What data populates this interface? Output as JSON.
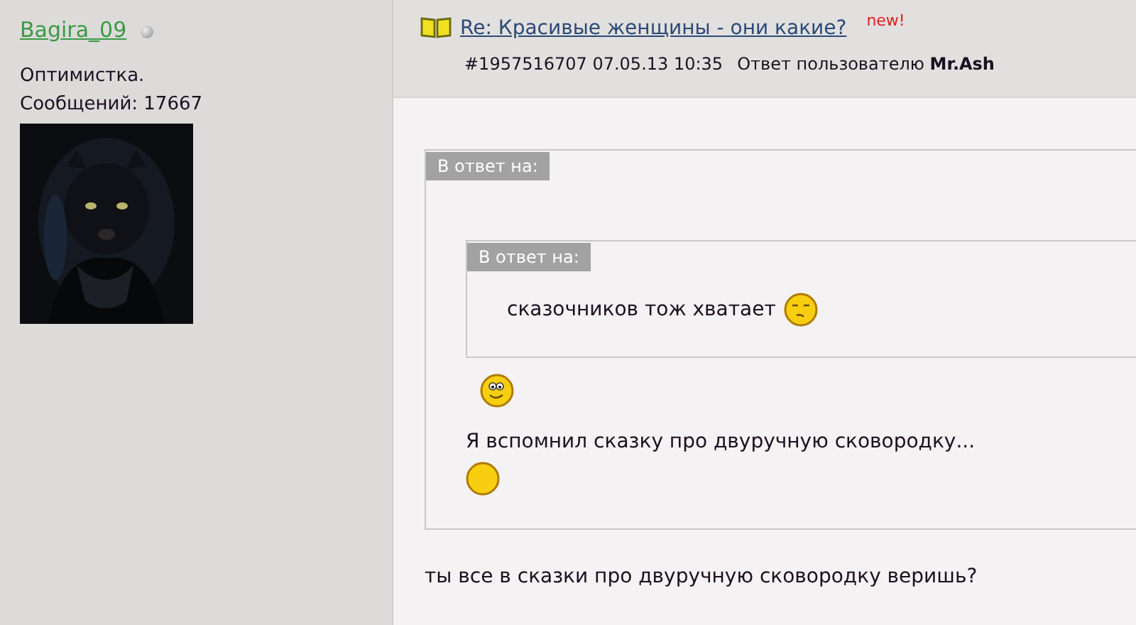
{
  "user": {
    "name": "Bagira_09",
    "online": false,
    "status": "Оптимистка.",
    "posts": "Сообщений: 17667"
  },
  "post": {
    "title": "Re: Красивые женщины - они какие?",
    "badge": "new!",
    "meta": "#1957516707 07.05.13 10:35",
    "reply_to": "Ответ пользователю **Mr.Ash**",
    "body": [
      {
        "kind": "quote",
        "label": "В ответ на:",
        "body": [
          {
            "kind": "quote",
            "label": "В ответ на:",
            "body": [
              {
                "kind": "line",
                "parts": [
                  {
                    "kind": "text",
                    "text": "сказочников тож хватает"
                  },
                  {
                    "kind": "smirk"
                  }
                ]
              }
            ]
          },
          {
            "kind": "line",
            "parts": [
              {
                "kind": "grin"
              }
            ]
          },
          {
            "kind": "line",
            "parts": [
              {
                "kind": "text",
                "text": "Я вспомнил сказку про двуручную сковородку..."
              }
            ]
          },
          {
            "kind": "line",
            "parts": [
              {
                "kind": "plain"
              }
            ]
          }
        ]
      },
      {
        "kind": "line",
        "parts": [
          {
            "kind": "text",
            "text": "ты все в сказки про двуручную сковородку веришь?"
          }
        ]
      }
    ]
  }
}
